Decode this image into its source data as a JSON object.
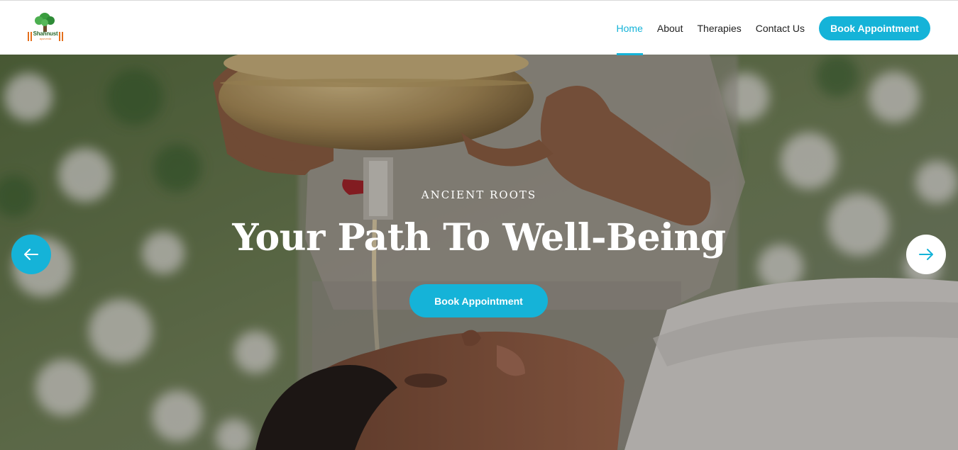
{
  "brand": {
    "logo_text": "Shahnust",
    "logo_subtext": "ayurveda",
    "icon": "tree-logo-icon",
    "colors": {
      "leaf": "#3a9d3f",
      "trunk": "#6b4a2a",
      "accent": "#e46f1c"
    }
  },
  "nav": {
    "items": [
      {
        "label": "Home",
        "active": true
      },
      {
        "label": "About",
        "active": false
      },
      {
        "label": "Therapies",
        "active": false
      },
      {
        "label": "Contact Us",
        "active": false
      }
    ],
    "cta_label": "Book Appointment"
  },
  "hero": {
    "eyebrow": "ANCIENT ROOTS",
    "headline": "Your Path To Well-Being",
    "cta_label": "Book Appointment",
    "prev_icon": "arrow-left-icon",
    "next_icon": "arrow-right-icon",
    "image": "shirodhara-treatment-photo"
  },
  "theme": {
    "accent": "#15b3d8",
    "text": "#222222",
    "white": "#ffffff"
  }
}
